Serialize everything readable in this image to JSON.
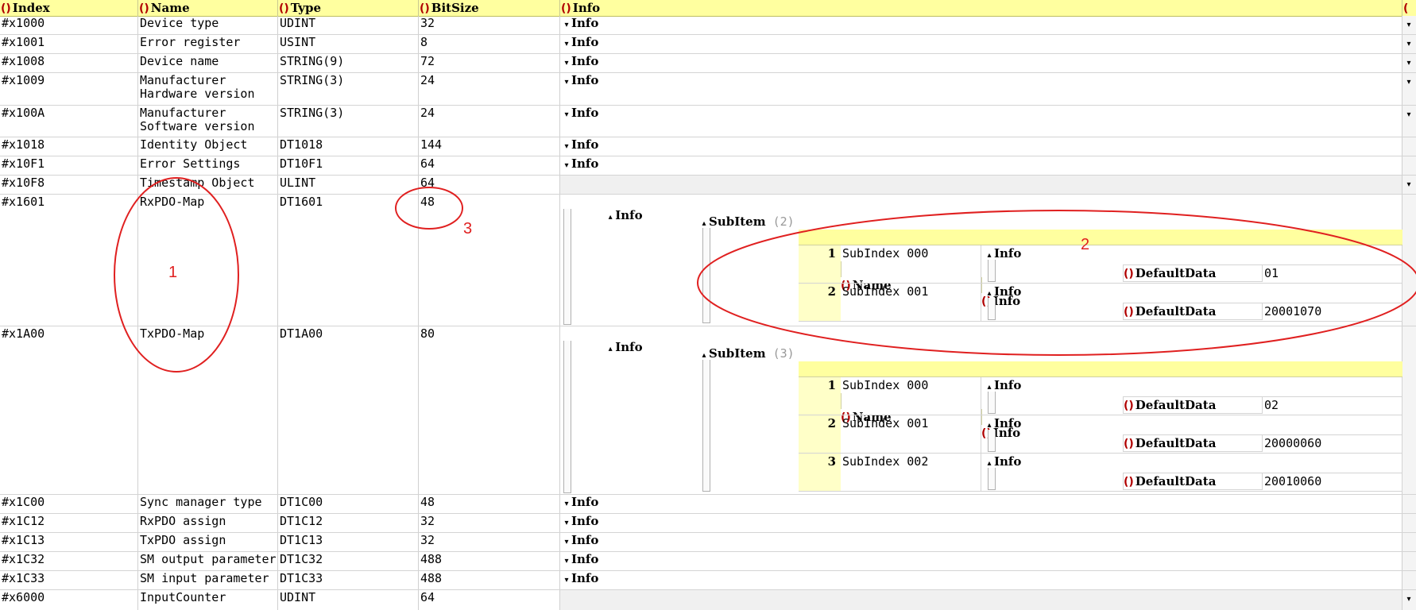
{
  "headers": {
    "index": "Index",
    "name": "Name",
    "type": "Type",
    "bitsize": "BitSize",
    "info": "Info"
  },
  "info_label": "Info",
  "rows": [
    {
      "index": "#x1000",
      "name": "Device type",
      "type": "UDINT",
      "bitsize": "32",
      "info": "Info"
    },
    {
      "index": "#x1001",
      "name": "Error register",
      "type": "USINT",
      "bitsize": "8",
      "info": "Info"
    },
    {
      "index": "#x1008",
      "name": "Device name",
      "type": "STRING(9)",
      "bitsize": "72",
      "info": "Info"
    },
    {
      "index": "#x1009",
      "name": "Manufacturer\nHardware version",
      "type": "STRING(3)",
      "bitsize": "24",
      "info": "Info"
    },
    {
      "index": "#x100A",
      "name": "Manufacturer\nSoftware version",
      "type": "STRING(3)",
      "bitsize": "24",
      "info": "Info"
    },
    {
      "index": "#x1018",
      "name": "Identity Object",
      "type": "DT1018",
      "bitsize": "144",
      "info": "Info"
    },
    {
      "index": "#x10F1",
      "name": "Error Settings",
      "type": "DT10F1",
      "bitsize": "64",
      "info": "Info"
    },
    {
      "index": "#x10F8",
      "name": "Timestamp Object",
      "type": "ULINT",
      "bitsize": "64",
      "info": ""
    },
    {
      "index": "#x1601",
      "name": "RxPDO-Map",
      "type": "DT1601",
      "bitsize": "48",
      "info": "Info"
    },
    {
      "index": "#x1A00",
      "name": "TxPDO-Map",
      "type": "DT1A00",
      "bitsize": "80",
      "info": "Info"
    },
    {
      "index": "#x1C00",
      "name": "Sync manager type",
      "type": "DT1C00",
      "bitsize": "48",
      "info": "Info"
    },
    {
      "index": "#x1C12",
      "name": "RxPDO assign",
      "type": "DT1C12",
      "bitsize": "32",
      "info": "Info"
    },
    {
      "index": "#x1C13",
      "name": "TxPDO assign",
      "type": "DT1C13",
      "bitsize": "32",
      "info": "Info"
    },
    {
      "index": "#x1C32",
      "name": "SM output parameter",
      "type": "DT1C32",
      "bitsize": "488",
      "info": "Info"
    },
    {
      "index": "#x1C33",
      "name": "SM input parameter",
      "type": "DT1C33",
      "bitsize": "488",
      "info": "Info"
    },
    {
      "index": "#x6000",
      "name": "InputCounter",
      "type": "UDINT",
      "bitsize": "64",
      "info": ""
    }
  ],
  "subitems_1601": {
    "label": "SubItem",
    "count": "(2)",
    "hdr_name": "Name",
    "hdr_info": "Info",
    "items": [
      {
        "num": "1",
        "name": "SubIndex 000",
        "info": "Info",
        "dd_label": "DefaultData",
        "dd_value": "01"
      },
      {
        "num": "2",
        "name": "SubIndex 001",
        "info": "Info",
        "dd_label": "DefaultData",
        "dd_value": "20001070"
      }
    ]
  },
  "subitems_1a00": {
    "label": "SubItem",
    "count": "(3)",
    "hdr_name": "Name",
    "hdr_info": "Info",
    "items": [
      {
        "num": "1",
        "name": "SubIndex 000",
        "info": "Info",
        "dd_label": "DefaultData",
        "dd_value": "02"
      },
      {
        "num": "2",
        "name": "SubIndex 001",
        "info": "Info",
        "dd_label": "DefaultData",
        "dd_value": "20000060"
      },
      {
        "num": "3",
        "name": "SubIndex 002",
        "info": "Info",
        "dd_label": "DefaultData",
        "dd_value": "20010060"
      }
    ]
  },
  "annotations": {
    "a1": "1",
    "a2": "2",
    "a3": "3",
    "color": "#e02020"
  },
  "icons": {
    "brace": "brace-icon",
    "expanded": "triangle-up-icon",
    "collapsed": "triangle-down-icon"
  }
}
